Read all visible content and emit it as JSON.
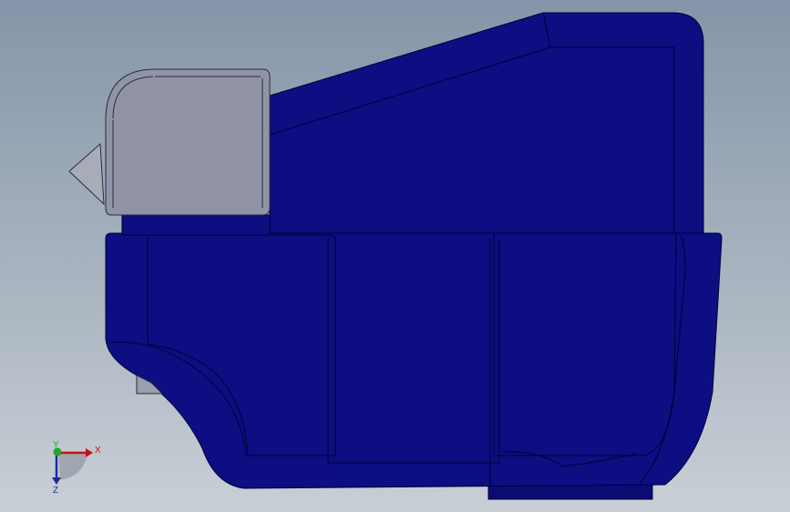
{
  "viewport": {
    "background_top": "#8595a9",
    "background_bottom": "#c9cfd6"
  },
  "model": {
    "body_color": "#0c0e82",
    "body_edge_color": "#000033",
    "sensor_color": "#9094a6",
    "sensor_edge_color": "#2a2c3a"
  },
  "triad": {
    "x_label": "X",
    "y_label": "Y",
    "z_label": "Z",
    "x_color": "#c0141a",
    "y_color": "#1fa82a",
    "z_color": "#1a2a9c"
  }
}
